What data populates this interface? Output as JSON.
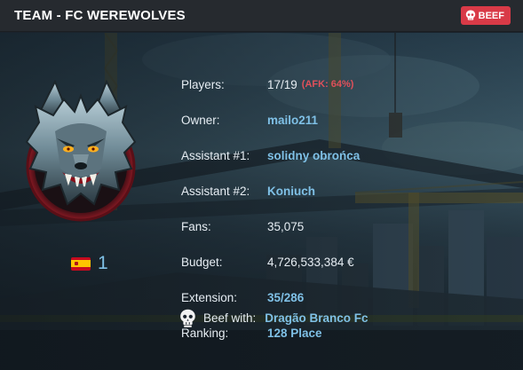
{
  "header": {
    "title": "TEAM - FC WEREWOLVES",
    "beef_badge": "BEEF"
  },
  "country": {
    "flag": "spain-flag",
    "rank": "1"
  },
  "info": {
    "players": {
      "label": "Players:",
      "value": "17/19",
      "afk": "(AFK: 64%)"
    },
    "owner": {
      "label": "Owner:",
      "value": "mailo211"
    },
    "assistant1": {
      "label": "Assistant #1:",
      "value": "solidny obrońca"
    },
    "assistant2": {
      "label": "Assistant #2:",
      "value": "Koniuch"
    },
    "fans": {
      "label": "Fans:",
      "value": "35,075"
    },
    "budget": {
      "label": "Budget:",
      "value": "4,726,533,384 €"
    },
    "extension": {
      "label": "Extension:",
      "value": "35/286"
    },
    "ranking": {
      "label": "Ranking:",
      "value": "128 Place"
    }
  },
  "beef": {
    "label": "Beef with:",
    "team": "Dragão Branco Fc"
  },
  "colors": {
    "header_bg": "#262a2f",
    "badge_red": "#d93a47",
    "link_blue": "#7fc0e6",
    "afk_red": "#e0505a"
  }
}
